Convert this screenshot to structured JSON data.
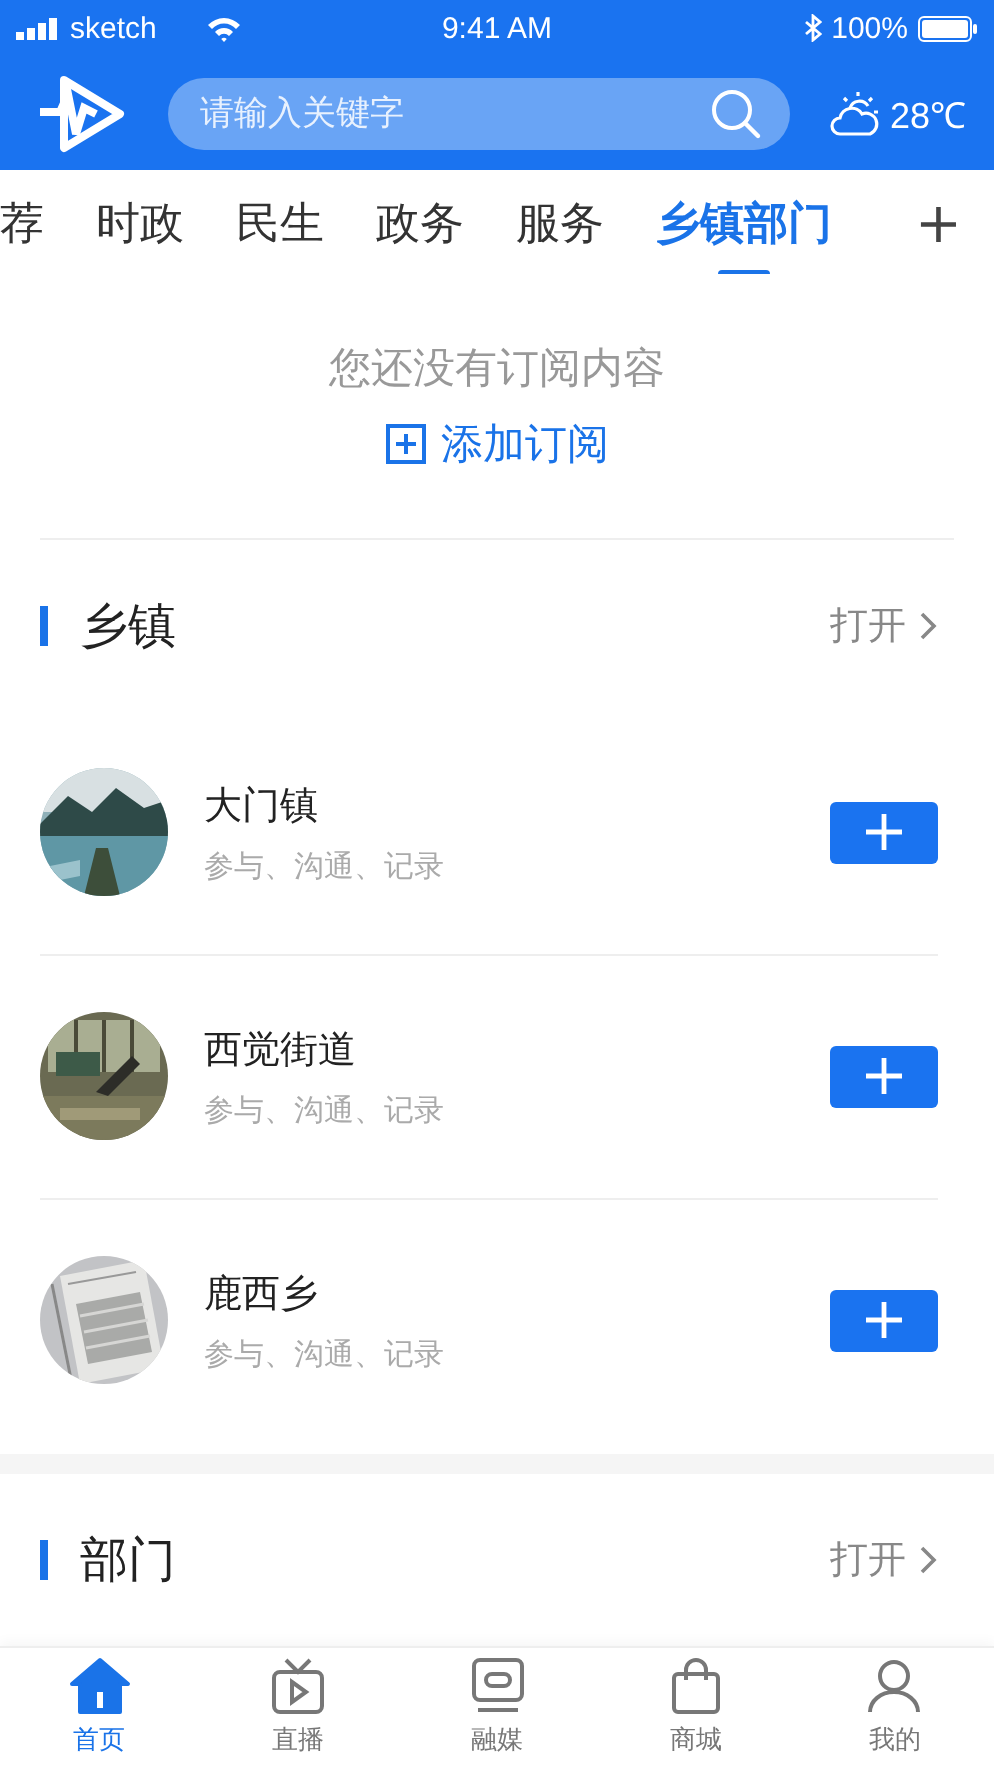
{
  "status_bar": {
    "carrier": "sketch",
    "time": "9:41 AM",
    "battery": "100%"
  },
  "header": {
    "search": {
      "placeholder": "请输入关键字"
    },
    "weather": {
      "temperature": "28℃"
    }
  },
  "tabs": [
    {
      "label": "荐",
      "selected": false
    },
    {
      "label": "时政",
      "selected": false
    },
    {
      "label": "民生",
      "selected": false
    },
    {
      "label": "政务",
      "selected": false
    },
    {
      "label": "服务",
      "selected": false
    },
    {
      "label": "乡镇部门",
      "selected": true
    }
  ],
  "add_tab": "+",
  "empty_state": {
    "message": "您还没有订阅内容",
    "action": "添加订阅"
  },
  "sections": [
    {
      "title": "乡镇",
      "more": "打开",
      "items": [
        {
          "name": "大门镇",
          "description": "参与、沟通、记录",
          "kind": "picture"
        },
        {
          "name": "西觉街道",
          "description": "参与、沟通、记录",
          "kind": "picture"
        },
        {
          "name": "鹿西乡",
          "description": "参与、沟通、记录",
          "kind": "picture"
        }
      ]
    },
    {
      "title": "部门",
      "more": "打开"
    }
  ],
  "bottom_nav": [
    {
      "label": "首页",
      "selected": true
    },
    {
      "label": "直播",
      "selected": false
    },
    {
      "label": "融媒",
      "selected": false
    },
    {
      "label": "商城",
      "selected": false
    },
    {
      "label": "我的",
      "selected": false
    }
  ]
}
